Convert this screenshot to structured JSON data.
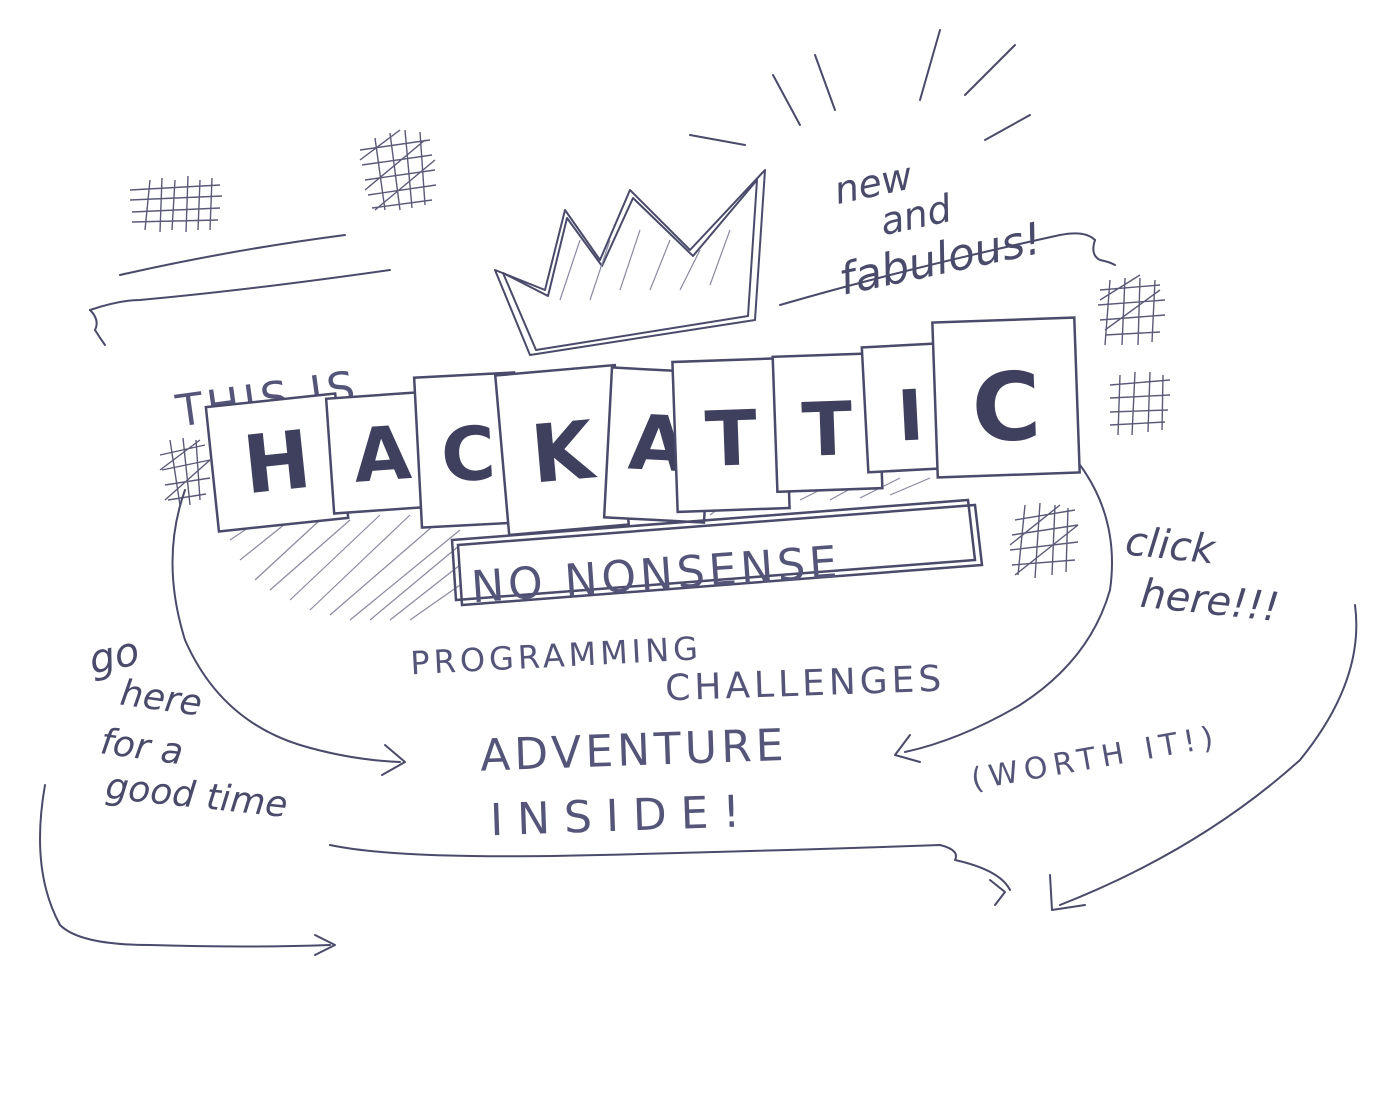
{
  "intro": "THIS IS",
  "brand": {
    "letters": [
      "H",
      "A",
      "C",
      "K",
      "A",
      "T",
      "T",
      "I",
      "C"
    ]
  },
  "tag_new": [
    "new",
    "and",
    "fabulous!"
  ],
  "banner": "NO NONSENSE",
  "subtitle": [
    "PROGRAMMING",
    "CHALLENGES"
  ],
  "adventure": [
    "ADVENTURE",
    "INSIDE!"
  ],
  "note_left": [
    "go",
    "here",
    "for a",
    "good time"
  ],
  "note_right": [
    "click",
    "here!!!",
    "(WORTH IT!)"
  ],
  "colors": {
    "ink": "#4a4a6a",
    "paper": "#ffffff"
  }
}
